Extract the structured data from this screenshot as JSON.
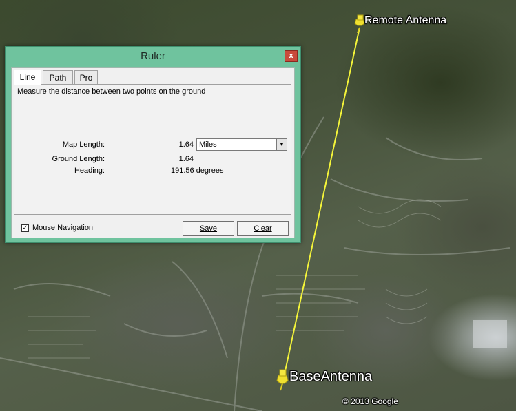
{
  "map": {
    "start_label": "Remote Antenna",
    "end_label": "BaseAntenna",
    "copyright": "© 2013 Google",
    "line_color": "#f5f53a"
  },
  "ruler": {
    "title": "Ruler",
    "close_glyph": "x",
    "tabs": [
      {
        "label": "Line",
        "active": true
      },
      {
        "label": "Path",
        "active": false
      },
      {
        "label": "Pro",
        "active": false
      }
    ],
    "description": "Measure the distance between two points on the ground",
    "map_length_label": "Map Length:",
    "map_length_value": "1.64",
    "units_selected": "Miles",
    "ground_length_label": "Ground Length:",
    "ground_length_value": "1.64",
    "heading_label": "Heading:",
    "heading_value": "191.56 degrees",
    "mouse_navigation_label": "Mouse Navigation",
    "mouse_navigation_checked": true,
    "save_label": "Save",
    "clear_label": "Clear"
  }
}
